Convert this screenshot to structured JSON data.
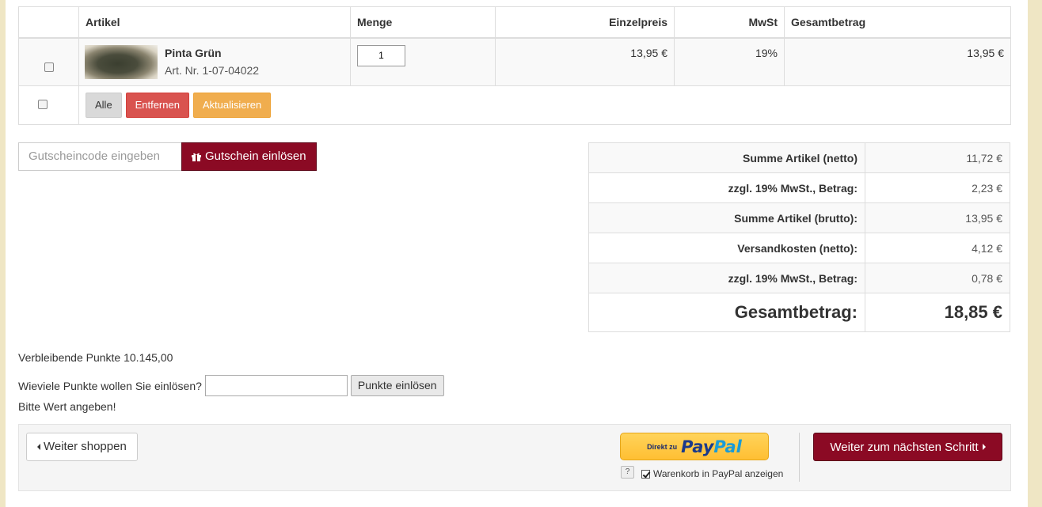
{
  "cart": {
    "headers": {
      "article": "Artikel",
      "quantity": "Menge",
      "unit_price": "Einzelpreis",
      "vat": "MwSt",
      "total": "Gesamtbetrag"
    },
    "items": [
      {
        "name": "Pinta Grün",
        "art_nr": "Art. Nr. 1-07-04022",
        "quantity": "1",
        "unit_price": "13,95 €",
        "vat": "19%",
        "total": "13,95 €",
        "thumbnail_icon": "yarn-skein-image"
      }
    ],
    "actions": {
      "all": "Alle",
      "remove": "Entfernen",
      "update": "Aktualisieren"
    }
  },
  "voucher": {
    "placeholder": "Gutscheincode eingeben",
    "button": "Gutschein einlösen",
    "icon": "gift-icon"
  },
  "totals": [
    {
      "label": "Summe Artikel (netto)",
      "value": "11,72 €"
    },
    {
      "label": "zzgl. 19% MwSt., Betrag:",
      "value": "2,23 €"
    },
    {
      "label": "Summe Artikel (brutto):",
      "value": "13,95 €"
    },
    {
      "label": "Versandkosten (netto):",
      "value": "4,12 €"
    },
    {
      "label": "zzgl. 19% MwSt., Betrag:",
      "value": "0,78 €"
    },
    {
      "label": "Gesamtbetrag:",
      "value": "18,85 €"
    }
  ],
  "points": {
    "remaining": "Verbleibende Punkte 10.145,00",
    "question": "Wieviele Punkte wollen Sie einlösen?",
    "button": "Punkte einlösen",
    "hint": "Bitte Wert angeben!"
  },
  "footer": {
    "continue_shopping": "Weiter shoppen",
    "paypal_prefix": "Direkt zu",
    "paypal_pay": "Pay",
    "paypal_pal": "Pal",
    "paypal_help": "?",
    "paypal_show_cart": "Warenkorb in PayPal anzeigen",
    "next_step": "Weiter zum nächsten Schritt"
  },
  "colors": {
    "primary": "#8b0a24",
    "danger": "#d9534f",
    "warning": "#f0ad4e",
    "paypal_yellow": "#ffc439",
    "page_border": "#efe6c4"
  }
}
